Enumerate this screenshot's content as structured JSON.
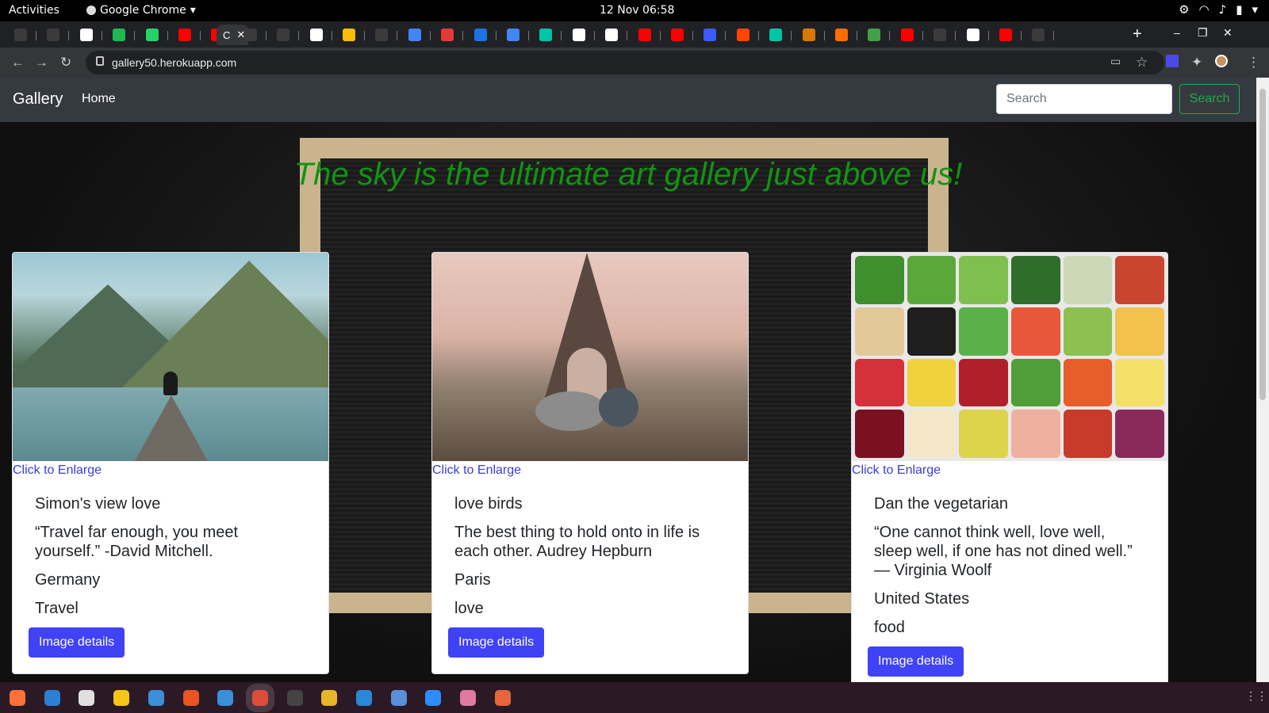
{
  "system": {
    "activities": "Activities",
    "app_name": "Google Chrome",
    "clock": "12 Nov  06:58"
  },
  "browser": {
    "url": "gallery50.herokuapp.com",
    "active_tab_label": "C",
    "tab_favicon_colors": [
      "#3b3b3b",
      "#3b3b3b",
      "#ffffff",
      "#1db954",
      "#25d366",
      "#ff0000",
      "#ff0000",
      "#3b3b3b",
      "#3b3b3b",
      "#ffffff",
      "#fbbc04",
      "#3b3b3b",
      "#4285f4",
      "#e53935",
      "#1a73e8",
      "#4285f4",
      "#00c4a7",
      "#ffffff",
      "#ffffff",
      "#ff0000",
      "#ff0000",
      "#3b5bff",
      "#ff4500",
      "#00c4a7",
      "#d97706",
      "#ff6d00",
      "#43a047",
      "#ff0000",
      "#3b3b3b",
      "#ffffff",
      "#ff0000",
      "#3b3b3b"
    ]
  },
  "navbar": {
    "brand": "Gallery",
    "home": "Home",
    "search_placeholder": "Search",
    "search_button": "Search"
  },
  "headline": "The sky is the ultimate art gallery just above us!",
  "enlarge_label": "Click to Enlarge",
  "details_button": "Image details",
  "cards": [
    {
      "name": "Simon's view love",
      "description": "“Travel far enough, you meet yourself.” -David Mitchell.",
      "location": "Germany",
      "category": "Travel"
    },
    {
      "name": "love birds",
      "description": "The best thing to hold onto in life is each other. Audrey Hepburn",
      "location": "Paris",
      "category": "love"
    },
    {
      "name": "Dan the vegetarian",
      "description": "“One cannot think well, love well, sleep well, if one has not dined well.” — Virginia Woolf",
      "location": "United States",
      "category": "food"
    }
  ],
  "colors": {
    "headline": "#139313",
    "primary_button": "#3f42f5",
    "search_outline": "#28a745",
    "navbar_bg": "#343a40"
  }
}
